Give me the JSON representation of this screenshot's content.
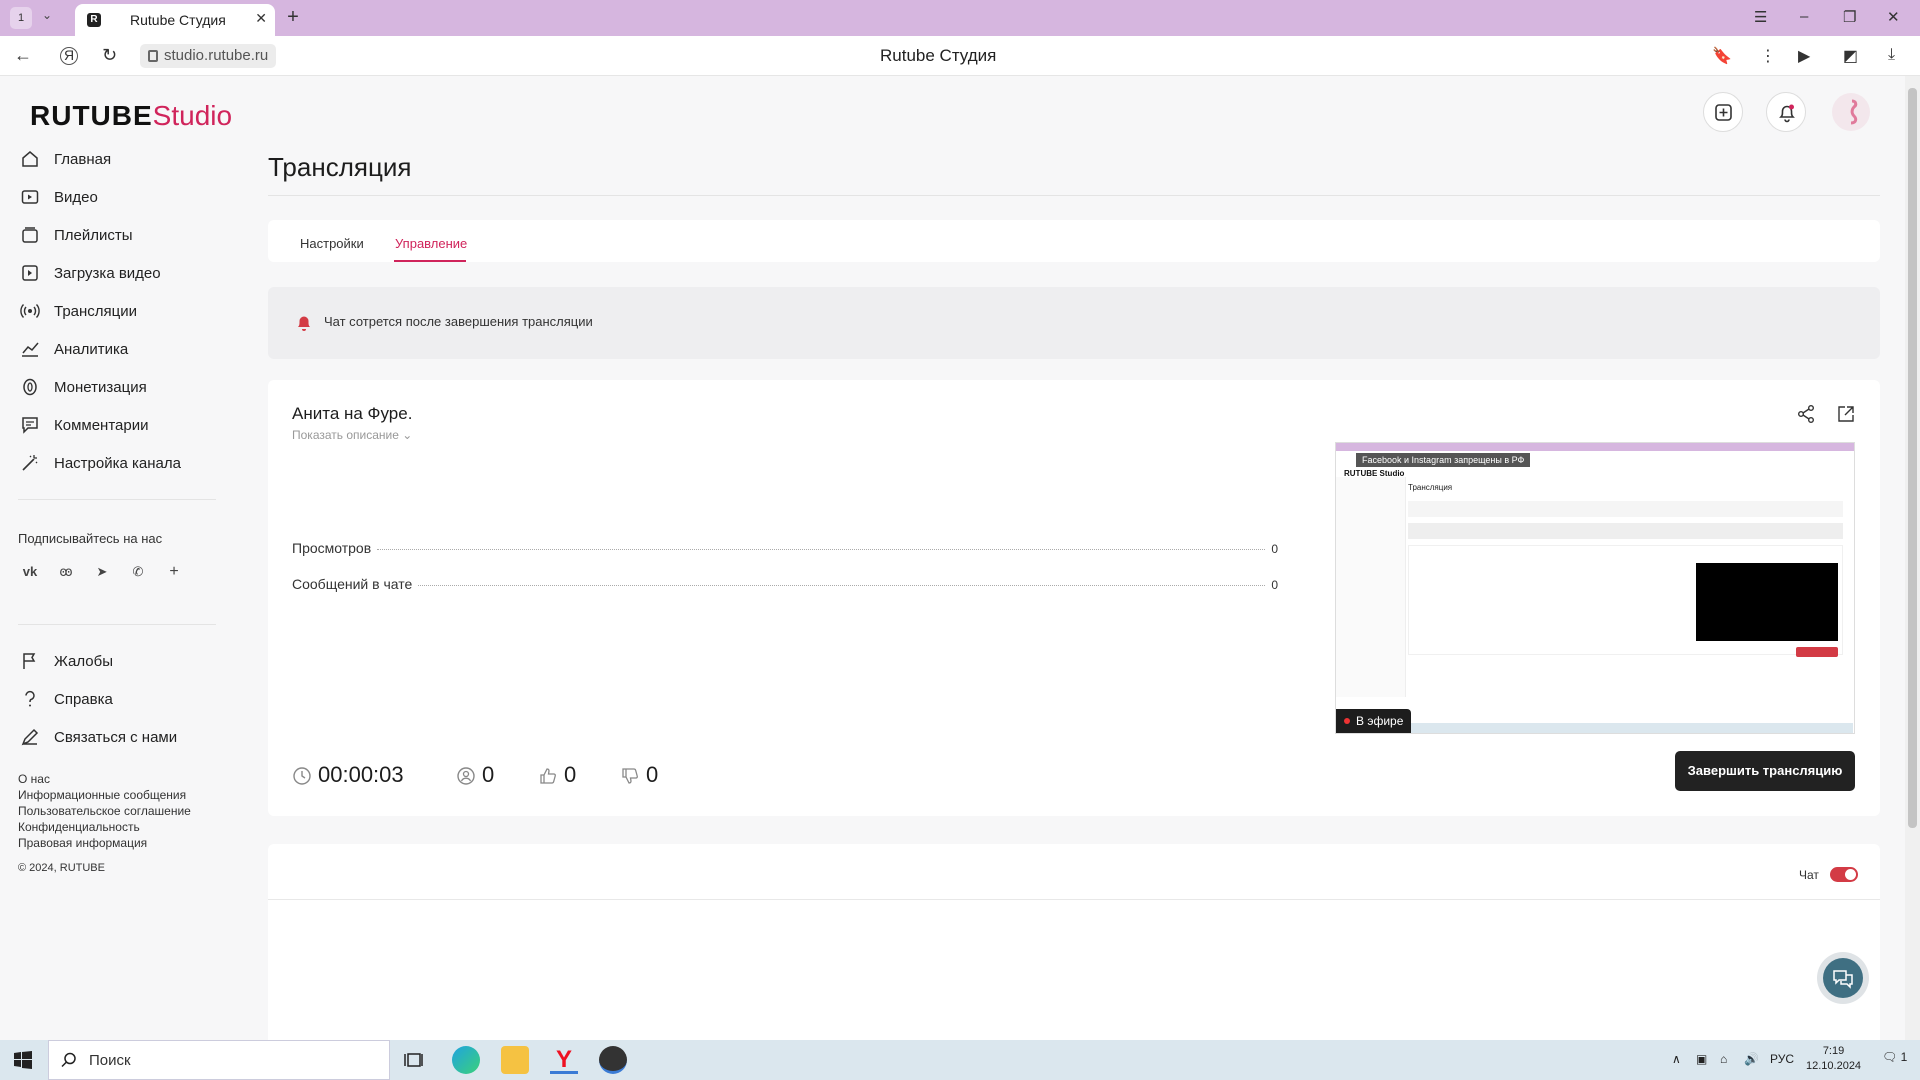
{
  "browser": {
    "tab_counter": "1",
    "tab_title": "Rutube Студия",
    "url": "studio.rutube.ru",
    "page_title": "Rutube Студия"
  },
  "logo": {
    "brand": "RUTUBE",
    "suffix": "Studio",
    "accent": "#d0245b"
  },
  "sidebar": {
    "items": [
      {
        "label": "Главная",
        "icon": "home-icon"
      },
      {
        "label": "Видео",
        "icon": "video-icon"
      },
      {
        "label": "Плейлисты",
        "icon": "playlist-icon"
      },
      {
        "label": "Загрузка видео",
        "icon": "upload-icon"
      },
      {
        "label": "Трансляции",
        "icon": "broadcast-icon"
      },
      {
        "label": "Аналитика",
        "icon": "analytics-icon"
      },
      {
        "label": "Монетизация",
        "icon": "money-icon"
      },
      {
        "label": "Комментарии",
        "icon": "comments-icon"
      },
      {
        "label": "Настройка канала",
        "icon": "wand-icon"
      }
    ],
    "follow_title": "Подписывайтесь на нас",
    "socials": [
      "vk",
      "ok",
      "telegram",
      "viber",
      "+"
    ],
    "support_items": [
      {
        "label": "Жалобы",
        "icon": "flag-icon"
      },
      {
        "label": "Справка",
        "icon": "help-icon"
      },
      {
        "label": "Связаться с нами",
        "icon": "pen-icon"
      }
    ],
    "footer_links": [
      "О нас",
      "Информационные сообщения",
      "Пользовательское соглашение",
      "Конфиденциальность",
      "Правовая информация"
    ],
    "copyright": "© 2024, RUTUBE"
  },
  "main": {
    "title": "Трансляция",
    "tabs": [
      {
        "label": "Настройки",
        "active": false
      },
      {
        "label": "Управление",
        "active": true
      }
    ],
    "notice": "Чат сотрется после завершения трансляции",
    "stream": {
      "title": "Анита на Фуре.",
      "show_description": "Показать описание",
      "stats": [
        {
          "label": "Просмотров",
          "value": "0"
        },
        {
          "label": "Сообщений в чате",
          "value": "0"
        }
      ],
      "duration": "00:00:03",
      "viewers": "0",
      "likes": "0",
      "dislikes": "0",
      "live_badge": "В эфире",
      "end_button": "Завершить трансляцию"
    },
    "preview": {
      "banner": "Facebook и Instagram запрещены в РФ",
      "logo": "RUTUBE Studio",
      "title": "Трансляция"
    },
    "chat": {
      "label": "Чат",
      "enabled": true,
      "toggle_color": "#d33b45"
    }
  },
  "taskbar": {
    "search_placeholder": "Поиск",
    "lang": "РУС",
    "time": "7:19",
    "date": "12.10.2024",
    "notifications": "1"
  }
}
